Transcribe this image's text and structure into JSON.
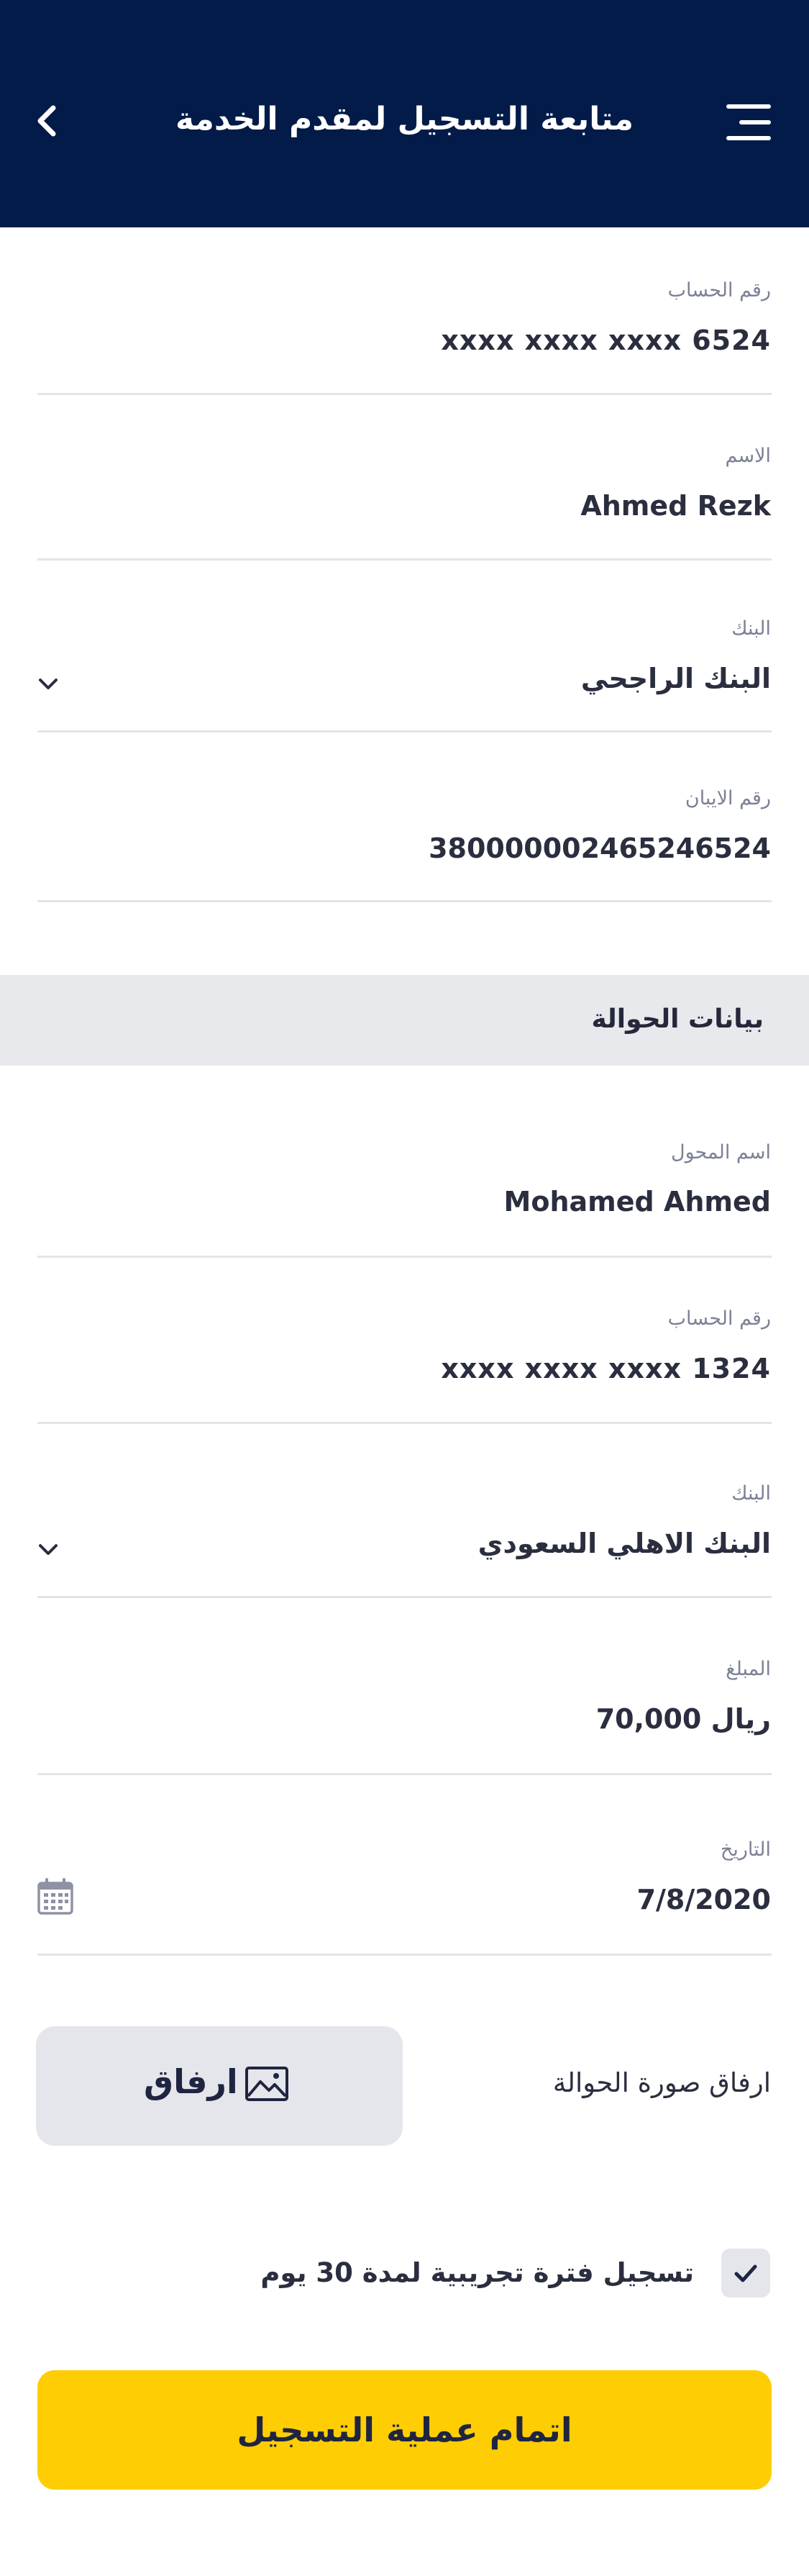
{
  "header": {
    "title": "متابعة التسجيل لمقدم الخدمة"
  },
  "account_section": {
    "account_number_label": "رقم الحساب",
    "account_number_value": "xxxx  xxxx  xxxx  6524",
    "name_label": "الاسم",
    "name_value": "Ahmed Rezk",
    "bank_label": "البنك",
    "bank_value": "البنك الراجحي",
    "iban_label": "رقم الايبان",
    "iban_value": "38000000246524652 4"
  },
  "transfer_section": {
    "title": "بيانات الحوالة",
    "sender_name_label": "اسم المحول",
    "sender_name_value": "Mohamed Ahmed",
    "account_number_label": "رقم الحساب",
    "account_number_value": "xxxx  xxxx  xxxx  1324",
    "bank_label": "البنك",
    "bank_value": "البنك الاهلي السعودي",
    "amount_label": "المبلغ",
    "amount_value": "70,000 ريال",
    "date_label": "التاريخ",
    "date_value": "7/8/2020"
  },
  "attachment": {
    "label": "ارفاق صورة الحوالة",
    "button_label": "ارفاق"
  },
  "trial": {
    "label": "تسجيل فترة تجريبية لمدة 30 يوم",
    "checked": true
  },
  "submit": {
    "label": "اتمام عملية التسجيل"
  },
  "colors": {
    "header_bg": "#031b49",
    "submit_bg": "#ffcd03",
    "section_bg": "#e8e9ed"
  }
}
